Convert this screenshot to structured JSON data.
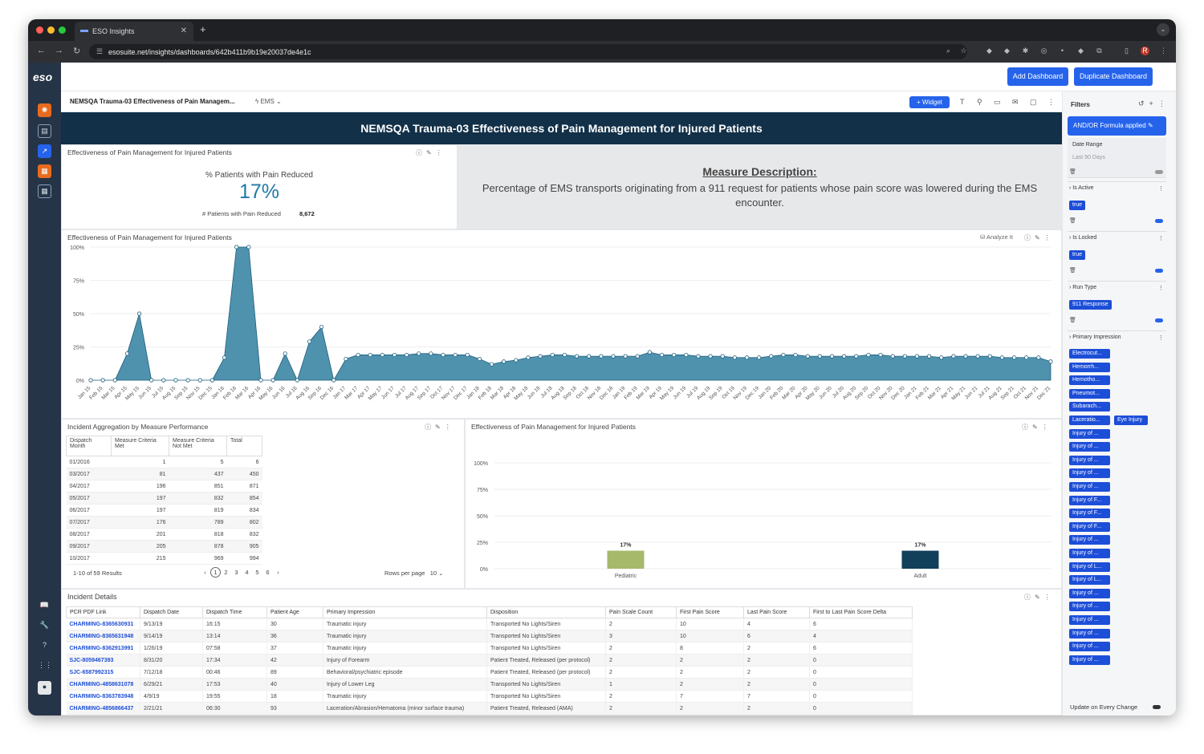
{
  "browser": {
    "tab_title": "ESO Insights",
    "url": "esosuite.net/insights/dashboards/642b411b9b19e20037de4e1c"
  },
  "app": {
    "logo": "eso",
    "add_dashboard": "Add Dashboard",
    "duplicate_dashboard": "Duplicate Dashboard"
  },
  "dashboard": {
    "name": "NEMSQA Trauma-03 Effectiveness of Pain Managem...",
    "context": "EMS",
    "widget_button": "+ Widget",
    "banner": "NEMSQA Trauma-03 Effectiveness of Pain Management for Injured Patients"
  },
  "kpi": {
    "title": "Effectiveness of Pain Management for Injured Patients",
    "label": "% Patients with Pain Reduced",
    "value": "17%",
    "sub_label": "# Patients with Pain Reduced",
    "sub_value": "8,672"
  },
  "description": {
    "heading": "Measure Description:",
    "text": "Percentage of EMS transports originating from a 911 request for patients whose pain score was lowered during the EMS encounter."
  },
  "line_title": "Effectiveness of Pain Management for Injured Patients",
  "analyze_label": "Analyze It",
  "agg": {
    "title": "Incident Aggregation by Measure Performance",
    "headers": [
      "Dispatch Month",
      "Measure Criteria Met",
      "Measure Criteria Not Met",
      "Total"
    ],
    "rows": [
      [
        "01/2016",
        "1",
        "5",
        "6"
      ],
      [
        "03/2017",
        "81",
        "437",
        "450"
      ],
      [
        "04/2017",
        "196",
        "851",
        "871"
      ],
      [
        "05/2017",
        "197",
        "832",
        "854"
      ],
      [
        "06/2017",
        "197",
        "819",
        "834"
      ],
      [
        "07/2017",
        "176",
        "789",
        "802"
      ],
      [
        "08/2017",
        "201",
        "818",
        "832"
      ],
      [
        "09/2017",
        "205",
        "878",
        "905"
      ],
      [
        "10/2017",
        "215",
        "969",
        "994"
      ]
    ],
    "results": "1-10 of 59 Results",
    "pages": [
      "1",
      "2",
      "3",
      "4",
      "5",
      "6"
    ],
    "rows_per_page_label": "Rows per page",
    "rows_per_page": "10"
  },
  "bar_title": "Effectiveness of Pain Management for Injured Patients",
  "details": {
    "title": "Incident Details",
    "headers": [
      "PCR PDF Link",
      "Dispatch Date",
      "Dispatch Time",
      "Patient Age",
      "Primary Impression",
      "Disposition",
      "Pain Scale Count",
      "First Pain Score",
      "Last Pain Score",
      "First to Last Pain Score Delta"
    ],
    "rows": [
      [
        "CHARMING-8365630931",
        "9/13/19",
        "16:15",
        "30",
        "Traumatic injury",
        "Transported No Lights/Siren",
        "2",
        "10",
        "4",
        "6"
      ],
      [
        "CHARMING-8365631948",
        "9/14/19",
        "13:14",
        "36",
        "Traumatic injury",
        "Transported No Lights/Siren",
        "3",
        "10",
        "6",
        "4"
      ],
      [
        "CHARMING-8362913991",
        "1/26/19",
        "07:58",
        "37",
        "Traumatic injury",
        "Transported No Lights/Siren",
        "2",
        "8",
        "2",
        "6"
      ],
      [
        "SJC-8059467393",
        "8/31/20",
        "17:34",
        "42",
        "Injury of Forearm",
        "Patient Treated, Released (per protocol)",
        "2",
        "2",
        "2",
        "0"
      ],
      [
        "SJC-6587992315",
        "7/12/18",
        "00:46",
        "89",
        "Behavioral/psychiatric episode",
        "Patient Treated, Released (per protocol)",
        "2",
        "2",
        "2",
        "0"
      ],
      [
        "CHARMING-4858631078",
        "6/29/21",
        "17:53",
        "40",
        "Injury of Lower Leg",
        "Transported No Lights/Siren",
        "1",
        "2",
        "2",
        "0"
      ],
      [
        "CHARMING-8363783948",
        "4/9/19",
        "19:55",
        "18",
        "Traumatic injury",
        "Transported No Lights/Siren",
        "2",
        "7",
        "7",
        "0"
      ],
      [
        "CHARMING-4856866437",
        "2/21/21",
        "06:30",
        "93",
        "Laceration/Abrasion/Hematoma (minor surface trauma)",
        "Patient Treated, Released (AMA)",
        "2",
        "2",
        "2",
        "0"
      ]
    ]
  },
  "filters": {
    "title": "Filters",
    "andor": "AND/OR Formula applied",
    "date_range_label": "Date Range",
    "date_range_value": "Last 90 Days",
    "is_active_label": "Is Active",
    "is_active_value": "true",
    "is_locked_label": "Is Locked",
    "is_locked_value": "true",
    "run_type_label": "Run Type",
    "run_type_value": "911 Response",
    "primary_impression_label": "Primary Impression",
    "impressions": [
      "Electrocut...",
      "Hemorrh...",
      "Hemotho...",
      "Pneumot...",
      "Subarach...",
      "Laceratio...",
      "Eye Injury",
      "Injury of ...",
      "Injury of ...",
      "Injury of ...",
      "Injury of ...",
      "Injury of ...",
      "Injury of F...",
      "Injury of F...",
      "Injury of F...",
      "Injury of ...",
      "Injury of ...",
      "Injury of L...",
      "Injury of L...",
      "Injury of ...",
      "Injury of ...",
      "Injury of ...",
      "Injury of ...",
      "Injury of ...",
      "Injury of ..."
    ],
    "update_label": "Update on Every Change"
  },
  "colors": {
    "brand": "#2563eb",
    "navy": "#123048",
    "area": "#2f7fa0",
    "pediatric": "#a6b86a",
    "adult": "#123f5a",
    "kpi": "#1e7aa8"
  },
  "chart_data": [
    {
      "type": "area",
      "title": "Effectiveness of Pain Management for Injured Patients",
      "x": [
        "Jan 15",
        "Feb 15",
        "Mar 15",
        "Apr 15",
        "May 15",
        "Jun 15",
        "Jul 15",
        "Aug 15",
        "Sep 15",
        "Nov 15",
        "Dec 15",
        "Jan 16",
        "Feb 16",
        "Mar 16",
        "Apr 16",
        "May 16",
        "Jun 16",
        "Jul 16",
        "Aug 16",
        "Sep 16",
        "Dec 16",
        "Jan 17",
        "Mar 17",
        "Apr 17",
        "May 17",
        "Jun 17",
        "Jul 17",
        "Aug 17",
        "Sep 17",
        "Oct 17",
        "Nov 17",
        "Dec 17",
        "Jan 18",
        "Feb 18",
        "Mar 18",
        "Apr 18",
        "May 18",
        "Jun 18",
        "Jul 18",
        "Aug 18",
        "Sep 18",
        "Oct 18",
        "Nov 18",
        "Dec 18",
        "Jan 19",
        "Feb 19",
        "Mar 19",
        "Apr 19",
        "May 19",
        "Jun 19",
        "Jul 19",
        "Aug 19",
        "Sep 19",
        "Oct 19",
        "Nov 19",
        "Dec 19",
        "Jan 20",
        "Feb 20",
        "Mar 20",
        "Apr 20",
        "May 20",
        "Jun 20",
        "Jul 20",
        "Aug 20",
        "Sep 20",
        "Oct 20",
        "Nov 20",
        "Dec 20",
        "Jan 21",
        "Feb 21",
        "Mar 21",
        "Apr 21",
        "May 21",
        "Jun 21",
        "Jul 21",
        "Aug 21",
        "Sep 21",
        "Oct 21",
        "Nov 21",
        "Dec 21"
      ],
      "values": [
        0,
        0,
        0,
        20,
        50,
        0,
        0,
        0,
        0,
        0,
        0,
        17,
        100,
        100,
        0,
        0,
        20,
        0,
        29,
        40,
        0,
        16,
        19,
        19,
        19,
        19,
        19,
        20,
        20,
        19,
        19,
        19,
        16,
        12,
        14,
        15,
        17,
        18,
        19,
        19,
        18,
        18,
        18,
        18,
        18,
        18,
        21,
        19,
        19,
        19,
        18,
        18,
        18,
        17,
        17,
        17,
        18,
        19,
        19,
        18,
        18,
        18,
        18,
        18,
        19,
        19,
        18,
        18,
        18,
        18,
        17,
        18,
        18,
        18,
        18,
        17,
        17,
        17,
        17,
        14
      ],
      "yticks": [
        "0%",
        "25%",
        "50%",
        "75%",
        "100%"
      ],
      "ylim": [
        0,
        100
      ]
    },
    {
      "type": "bar",
      "title": "Effectiveness of Pain Management for Injured Patients",
      "categories": [
        "Pediatric",
        "Adult"
      ],
      "values": [
        17,
        17
      ],
      "labels": [
        "17%",
        "17%"
      ],
      "yticks": [
        "0%",
        "25%",
        "50%",
        "75%",
        "100%"
      ],
      "ylim": [
        0,
        100
      ]
    }
  ]
}
